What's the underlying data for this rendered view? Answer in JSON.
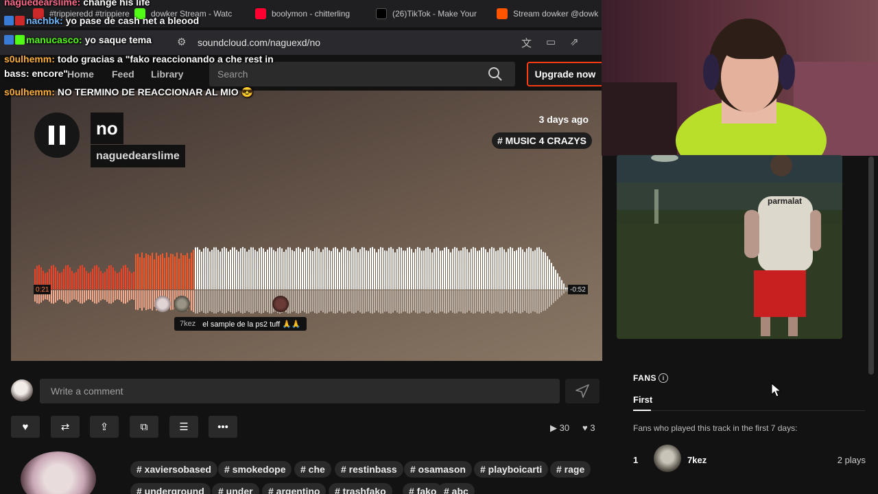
{
  "browser": {
    "tabs": [
      {
        "label": "#trippieredd #trippiere",
        "color": "#cc2a2a"
      },
      {
        "label": "dowker Stream - Watc",
        "color": "#53fc18"
      },
      {
        "label": "boolymon - chitterling",
        "color": "#ff0033"
      },
      {
        "label": "(26)TikTok - Make Your",
        "color": "#111111"
      },
      {
        "label": "Stream dowker @dowk",
        "color": "#ff5500"
      }
    ],
    "url": "soundcloud.com/naguexd/no"
  },
  "header": {
    "nav": [
      "Home",
      "Feed",
      "Library"
    ],
    "search_placeholder": "Search",
    "upgrade_label": "Upgrade now"
  },
  "track": {
    "title": "no",
    "artist": "naguedearslime",
    "posted": "3 days ago",
    "genre_tag": "# MUSIC 4 CRAZYS",
    "elapsed": "0:21",
    "remaining": "-0:52",
    "progress": 0.29,
    "timed_comment": {
      "user": "7kez",
      "text": "el sample de la ps2 tuff 🙏🙏"
    }
  },
  "comment_box": {
    "placeholder": "Write a comment"
  },
  "actions": [
    "heart-icon",
    "repost-icon",
    "share-icon",
    "copy-icon",
    "playlist-icon",
    "more-icon"
  ],
  "stats": {
    "plays": "30",
    "likes": "3"
  },
  "tags": [
    [
      "# xaviersobased",
      "# smokedope",
      "# che",
      "# restinbass",
      "# osamason",
      "# playboicarti",
      "# rage"
    ],
    [
      "# underground",
      "# under",
      "# argentino",
      "# trashfako",
      "# fako",
      "# abc"
    ]
  ],
  "fans": {
    "title": "FANS",
    "tab": "First",
    "description": "Fans who played this track in the first 7 days:",
    "list": [
      {
        "rank": "1",
        "name": "7kez",
        "plays": "2 plays"
      }
    ]
  },
  "artwork": {
    "shirt_text": "parmalat"
  },
  "chat": [
    {
      "nick": "naguedearslime:",
      "text": "change his life",
      "color": "#ff6a8a"
    },
    {
      "nick": "nachbk:",
      "text": "yo pase de cash net a bleood",
      "color": "#6fb8ff"
    },
    {
      "nick": "manucasco:",
      "text": "yo saque tema",
      "color": "#53fc18"
    },
    {
      "nick": "s0ulhemm:",
      "text": "todo gracias a \"fako reaccionando a che rest in",
      "color": "#ffb03b"
    },
    {
      "nick": "",
      "text": "bass: encore\"",
      "color": "#ffffff"
    },
    {
      "nick": "s0ulhemm:",
      "text": "NO TERMINO DE REACCIONAR AL MIO 😎",
      "color": "#ffb03b"
    }
  ]
}
